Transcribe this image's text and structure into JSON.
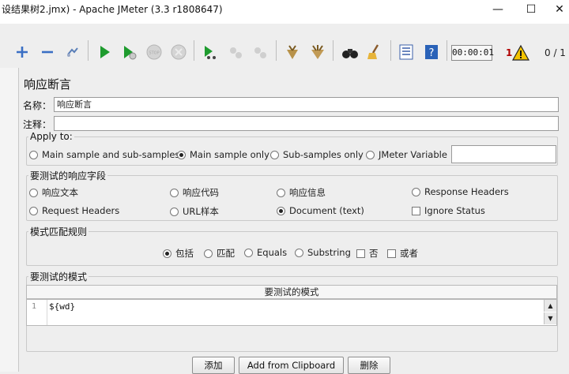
{
  "window": {
    "title": "设结果树2.jmx) - Apache JMeter (3.3 r1808647)",
    "minimize": "—",
    "maximize": "☐",
    "close": "✕"
  },
  "toolbar": {
    "timer": "00:00:01",
    "error_count": "1",
    "threads": "0 / 1",
    "icons": [
      "expand-plus-icon",
      "collapse-minus-icon",
      "toggle-icon",
      "start-icon",
      "start-no-pause-icon",
      "stop-icon",
      "shutdown-icon",
      "remote-start-icon",
      "remote-stop-icon",
      "remote-shutdown-icon",
      "clear-icon",
      "clear-all-icon",
      "search-binoculars-icon",
      "reset-search-broom-icon",
      "function-helper-icon",
      "help-icon"
    ],
    "warning_icon": "warning-triangle-icon"
  },
  "panel": {
    "title": "响应断言",
    "name_label": "名称：",
    "name_value": "响应断言",
    "comment_label": "注释：",
    "comment_value": ""
  },
  "apply_to": {
    "legend": "Apply to:",
    "options": [
      {
        "label": "Main sample and sub-samples",
        "selected": false
      },
      {
        "label": "Main sample only",
        "selected": true
      },
      {
        "label": "Sub-samples only",
        "selected": false
      },
      {
        "label": "JMeter Variable",
        "selected": false
      }
    ],
    "variable_value": ""
  },
  "field_to_test": {
    "legend": "要测试的响应字段",
    "options": [
      {
        "label": "响应文本",
        "selected": false
      },
      {
        "label": "响应代码",
        "selected": false
      },
      {
        "label": "响应信息",
        "selected": false
      },
      {
        "label": "Response Headers",
        "selected": false
      },
      {
        "label": "Request Headers",
        "selected": false
      },
      {
        "label": "URL样本",
        "selected": false
      },
      {
        "label": "Document (text)",
        "selected": true
      }
    ],
    "ignore_status": {
      "label": "Ignore Status",
      "checked": false
    }
  },
  "pattern_rules": {
    "legend": "模式匹配规则",
    "options": [
      {
        "label": "包括",
        "selected": true
      },
      {
        "label": "匹配",
        "selected": false
      },
      {
        "label": "Equals",
        "selected": false
      },
      {
        "label": "Substring",
        "selected": false
      }
    ],
    "not": {
      "label": "否",
      "checked": false
    },
    "or": {
      "label": "或者",
      "checked": false
    }
  },
  "patterns": {
    "legend": "要测试的模式",
    "column_header": "要测试的模式",
    "rows": [
      {
        "line": "1",
        "value": "${wd}"
      }
    ],
    "scroll_up": "▲",
    "scroll_down": "▼"
  },
  "buttons": {
    "add": "添加",
    "add_from_clipboard": "Add from Clipboard",
    "delete": "删除"
  }
}
